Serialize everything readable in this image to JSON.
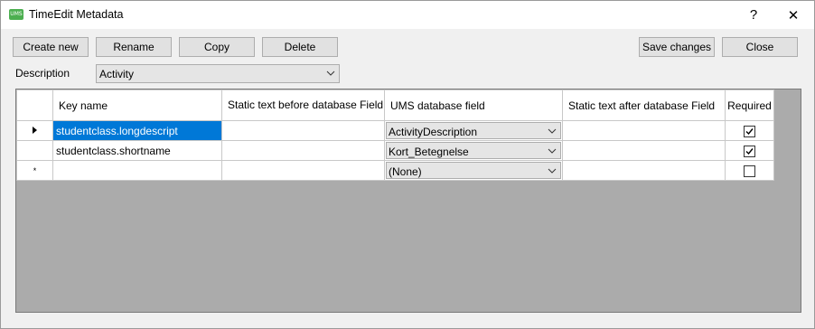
{
  "window": {
    "title": "TimeEdit Metadata",
    "icon_text": "UMS",
    "help_label": "?",
    "close_label": "✕"
  },
  "toolbar": {
    "create_new": "Create new",
    "rename": "Rename",
    "copy": "Copy",
    "delete": "Delete",
    "save_changes": "Save changes",
    "close": "Close"
  },
  "description": {
    "label": "Description",
    "value": "Activity"
  },
  "grid": {
    "columns": [
      "Key name",
      "Static text before database Field",
      "UMS database field",
      "Static text after database Field",
      "Required"
    ],
    "rows": [
      {
        "indicator": "current-row",
        "key": "studentclass.longdescript",
        "before": "",
        "field": "ActivityDescription",
        "after": "",
        "required": true
      },
      {
        "indicator": "",
        "key": "studentclass.shortname",
        "before": "",
        "field": "Kort_Betegnelse",
        "after": "",
        "required": true
      },
      {
        "indicator": "*",
        "key": "",
        "before": "",
        "field": "(None)",
        "after": "",
        "required": false
      }
    ]
  },
  "colors": {
    "selection": "#0078d7",
    "grid_background": "#ababab",
    "button_face": "#e1e1e1"
  }
}
